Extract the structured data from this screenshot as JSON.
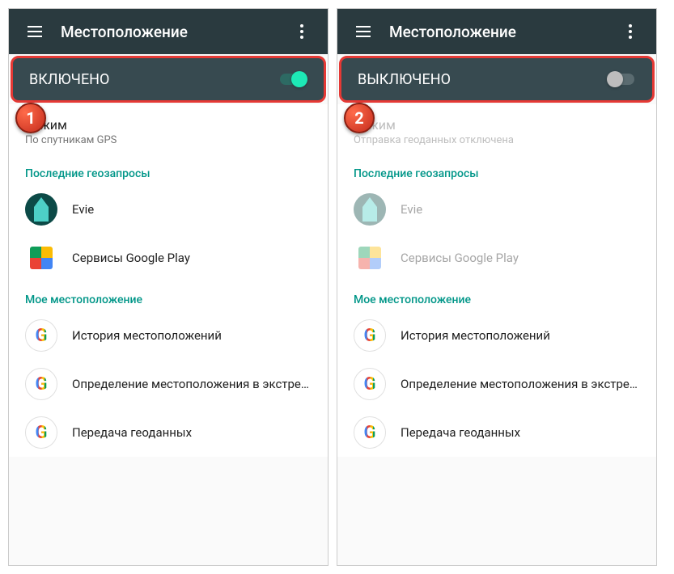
{
  "screens": [
    {
      "badge": "1",
      "appbar_title": "Местоположение",
      "toggle_label": "ВКЛЮЧЕНО",
      "toggle_on": true,
      "mode_title": "Режим",
      "mode_sub": "По спутникам GPS",
      "mode_disabled": false,
      "section_requests": "Последние геозапросы",
      "apps": [
        {
          "icon": "evie",
          "label": "Evie",
          "disabled": false
        },
        {
          "icon": "play",
          "label": "Сервисы Google Play",
          "disabled": false
        }
      ],
      "section_mylocation": "Мое местоположение",
      "services": [
        {
          "icon": "google",
          "label": "История местоположений"
        },
        {
          "icon": "google",
          "label": "Определение местоположения в экстрен.."
        },
        {
          "icon": "google",
          "label": "Передача геоданных"
        }
      ]
    },
    {
      "badge": "2",
      "appbar_title": "Местоположение",
      "toggle_label": "ВЫКЛЮЧЕНО",
      "toggle_on": false,
      "mode_title": "Режим",
      "mode_sub": "Отправка геоданных отключена",
      "mode_disabled": true,
      "section_requests": "Последние геозапросы",
      "apps": [
        {
          "icon": "evie",
          "label": "Evie",
          "disabled": true
        },
        {
          "icon": "play",
          "label": "Сервисы Google Play",
          "disabled": true
        }
      ],
      "section_mylocation": "Мое местоположение",
      "services": [
        {
          "icon": "google",
          "label": "История местоположений"
        },
        {
          "icon": "google",
          "label": "Определение местоположения в экстрен.."
        },
        {
          "icon": "google",
          "label": "Передача геоданных"
        }
      ]
    }
  ]
}
